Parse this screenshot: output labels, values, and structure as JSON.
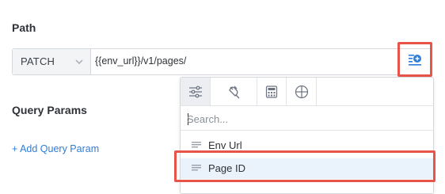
{
  "path": {
    "label": "Path",
    "method": "PATCH",
    "url_value": "{{env_url}}/v1/pages/"
  },
  "query": {
    "label": "Query Params",
    "add_label": "+ Add Query Param"
  },
  "variable_popup": {
    "tabs": [
      {
        "icon": "sliders-icon"
      },
      {
        "icon": "plug-icon"
      },
      {
        "icon": "calculator-icon"
      },
      {
        "icon": "grid-icon"
      }
    ],
    "search_placeholder": "Search...",
    "items": [
      {
        "label": "Env Url",
        "icon": "text-lines-icon"
      },
      {
        "label": "Page ID",
        "icon": "text-lines-icon"
      }
    ]
  },
  "colors": {
    "accent": "#2f7cd6",
    "highlight": "#e8544a",
    "selected_row": "#eaf2fb"
  }
}
